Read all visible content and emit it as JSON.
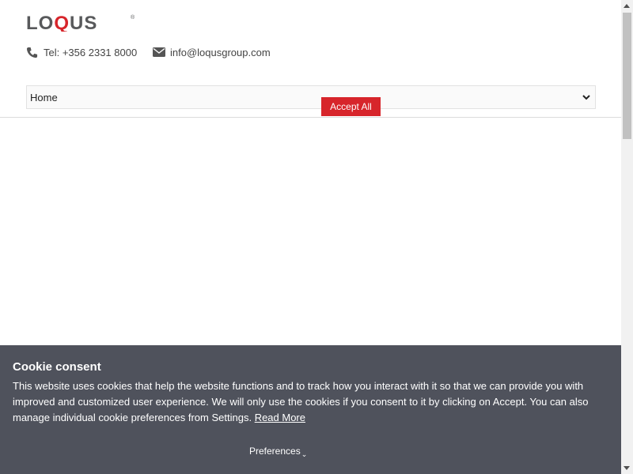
{
  "brand": {
    "logo_text": "LOQUS",
    "logo_mark": "®",
    "colors": {
      "grey": "#58595b",
      "red": "#d7252b"
    }
  },
  "contact": {
    "phone": "Tel: +356 2331 8000",
    "email": "info@loqusgroup.com",
    "phone_icon": "phone-icon",
    "email_icon": "envelope-icon"
  },
  "nav": {
    "selected": "Home"
  },
  "cookie": {
    "title": "Cookie consent",
    "text": "This website uses cookies that help the website functions and to track how you interact with it so that we can provide you with improved and customized user experience. We will only use the cookies if you consent to it by clicking on Accept. You can also manage individual cookie preferences from Settings.",
    "read_more": "Read More",
    "preferences_label": "Preferences",
    "accept_label": "Accept All",
    "colors": {
      "background": "#4f525c",
      "accept": "#d7252b"
    }
  }
}
